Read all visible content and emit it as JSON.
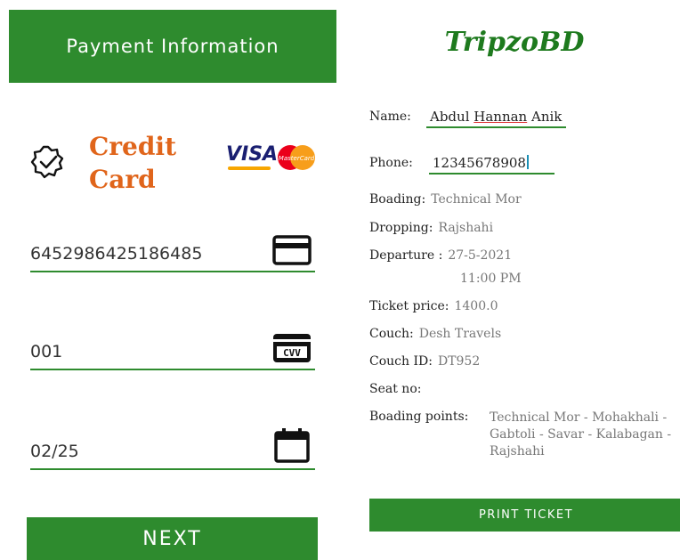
{
  "payment": {
    "header": "Payment Information",
    "card_title_line1": "Credit",
    "card_title_line2": "Card",
    "brand_visa": "VISA",
    "brand_mastercard": "MasterCard",
    "card_number": "6452986425186485",
    "cvv": "001",
    "cvv_icon_text": "CVV",
    "expiry": "02/25",
    "next_label": "NEXT"
  },
  "ticket": {
    "brand": "TripzoBD",
    "name_label": "Name:",
    "name_part1": "Abdul ",
    "name_part2": "Hannan",
    "name_part3": " Anik",
    "phone_label": "Phone:",
    "phone_value": "12345678908",
    "boarding_label": "Boading:",
    "boarding_value": "Technical Mor",
    "dropping_label": "Dropping:",
    "dropping_value": "Rajshahi",
    "departure_label": "Departure :",
    "departure_date": "27-5-2021",
    "departure_time": "11:00 PM",
    "price_label": "Ticket price:",
    "price_value": "1400.0",
    "coach_label": "Couch:",
    "coach_value": "Desh Travels",
    "coach_id_label": "Couch ID:",
    "coach_id_value": "DT952",
    "seat_label": "Seat no:",
    "boarding_points_label": "Boading points:",
    "boarding_points_line1": "Technical Mor - Mohakhali -",
    "boarding_points_line2": "Gabtoli - Savar - Kalabagan -",
    "boarding_points_line3": "Rajshahi",
    "print_label": "PRINT TICKET"
  },
  "colors": {
    "primary_green": "#2e8b2e",
    "credit_orange": "#e0651b",
    "brand_green": "#1e7a1e"
  }
}
